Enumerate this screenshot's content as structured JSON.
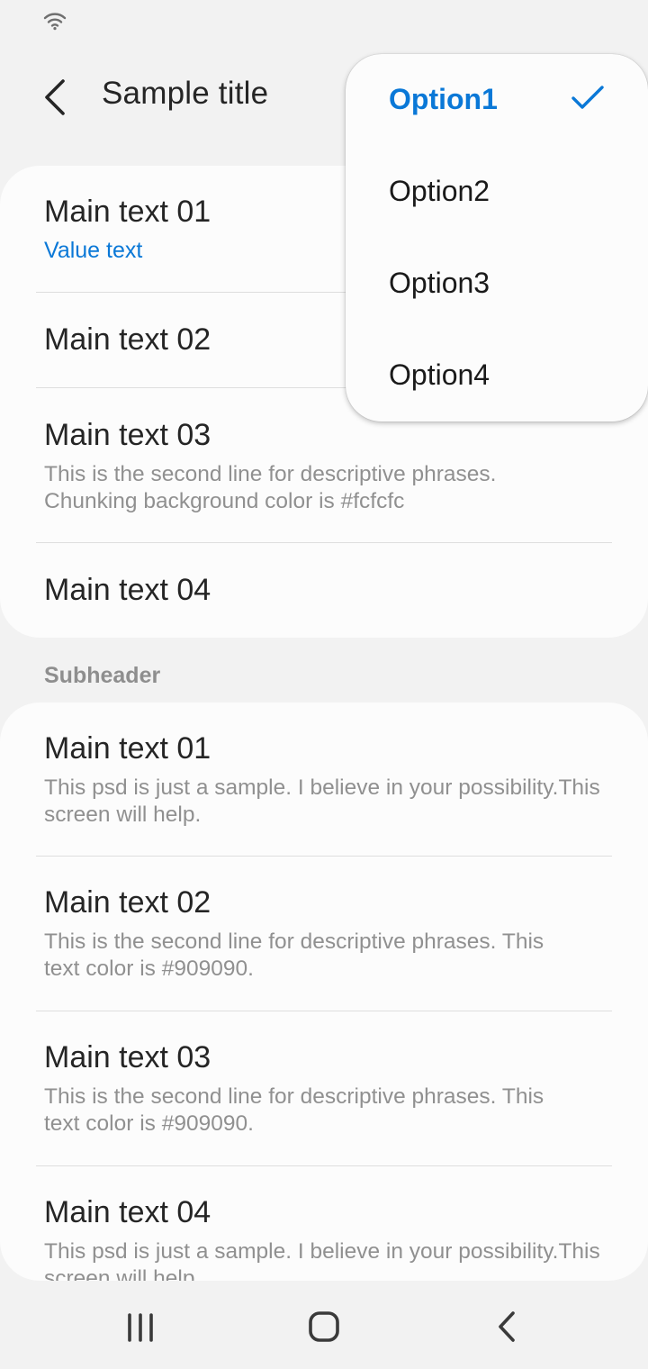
{
  "app_bar": {
    "title": "Sample title"
  },
  "card1": {
    "items": [
      {
        "main": "Main text 01",
        "value": "Value text"
      },
      {
        "main": "Main text 02"
      },
      {
        "main": "Main text 03",
        "sub": "This is the second line for descriptive phrases. Chunking background color is #fcfcfc"
      },
      {
        "main": "Main text 04"
      }
    ]
  },
  "subheader": "Subheader",
  "card2": {
    "items": [
      {
        "main": "Main text 01",
        "sub": "This psd is just a sample. I believe in your possibility.This screen will help."
      },
      {
        "main": "Main text 02",
        "sub": "This is the second line for descriptive phrases. This text color is #909090."
      },
      {
        "main": "Main text 03",
        "sub": "This is the second line for descriptive phrases. This text color is #909090."
      },
      {
        "main": "Main text 04",
        "sub": "This psd is just a sample. I believe in your possibility.This screen will help."
      }
    ]
  },
  "popup": {
    "options": [
      {
        "label": "Option1",
        "selected": true
      },
      {
        "label": "Option2",
        "selected": false
      },
      {
        "label": "Option3",
        "selected": false
      },
      {
        "label": "Option4",
        "selected": false
      }
    ]
  },
  "colors": {
    "accent": "#0a78d7",
    "card_background": "#fcfcfc",
    "secondary_text": "#909090",
    "screen_background": "#f2f2f2"
  },
  "icons": {
    "status": "wifi-icon",
    "back": "back-arrow-icon",
    "check": "check-icon",
    "nav_recent": "recent-apps-icon",
    "nav_home": "home-icon",
    "nav_back": "nav-back-icon"
  }
}
